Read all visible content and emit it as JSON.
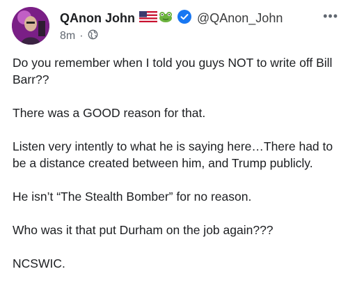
{
  "post": {
    "author": "QAnon John",
    "handle": "@QAnon_John",
    "time": "8m",
    "separator": "·",
    "more_label": "•••",
    "icons": {
      "flag": "us-flag-icon",
      "frog": "frog-icon",
      "verified": "verified-badge-icon",
      "privacy": "globe-icon",
      "more": "more-options-icon"
    },
    "colors": {
      "verified": "#1877f2",
      "text": "#1c1e21",
      "meta": "#606770"
    },
    "paragraphs": [
      "Do you remember when I told you guys NOT to write off Bill Barr??",
      "There was a GOOD reason for that.",
      "Listen very intently to what he is saying here…There had to be a distance created between him, and Trump publicly.",
      "He isn’t “The Stealth Bomber” for no reason.",
      "Who was it that put Durham on the job again???",
      "NCSWIC."
    ]
  }
}
